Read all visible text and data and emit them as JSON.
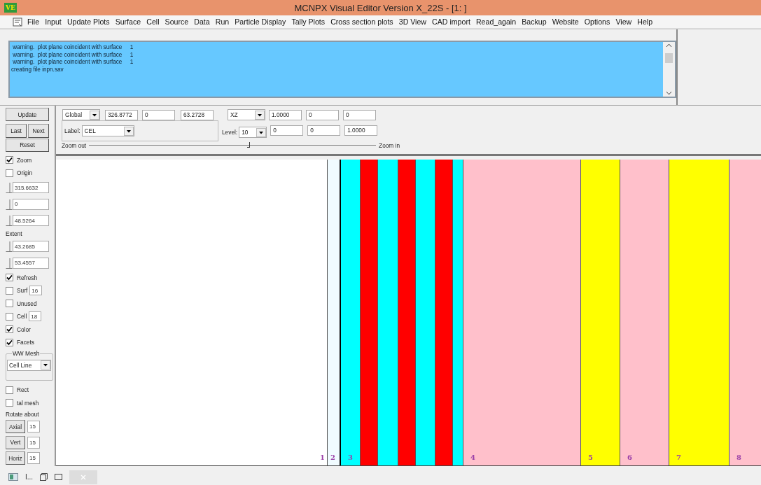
{
  "window": {
    "logo": "VE",
    "title": "MCNPX Visual Editor Version X_22S  - [1: ]"
  },
  "menu": [
    "File",
    "Input",
    "Update Plots",
    "Surface",
    "Cell",
    "Source",
    "Data",
    "Run",
    "Particle Display",
    "Tally Plots",
    "Cross section plots",
    "3D View",
    "CAD import",
    "Read_again",
    "Backup",
    "Website",
    "Options",
    "View",
    "Help"
  ],
  "messages": [
    " warning.  plot plane coincident with surface     1",
    " warning.  plot plane coincident with surface     1",
    " warning.  plot plane coincident with surface     1",
    "creating file inpn.sav"
  ],
  "toolbar": {
    "origin_mode": "Global",
    "origin": [
      "326.8772",
      "0",
      "63.2728"
    ],
    "plane": "XZ",
    "basis_1": [
      "1.0000",
      "0",
      "0"
    ],
    "label_title": "Label:",
    "label_value": "CEL",
    "level_title": "Level:",
    "level_value": "10",
    "basis_2": [
      "0",
      "0",
      "1.0000"
    ],
    "zoom_out": "Zoom out",
    "zoom_in": "Zoom in",
    "zoom": {
      "level": 0.55
    }
  },
  "sidebar": {
    "items": [
      {
        "kind": "button",
        "label": "Update"
      },
      {
        "kind": "button_pair",
        "labels": [
          "Last",
          "Next"
        ]
      },
      {
        "kind": "button",
        "label": "Reset"
      },
      {
        "kind": "checkbox",
        "label": "Zoom",
        "checked": true
      },
      {
        "kind": "checkbox",
        "label": "Origin",
        "checked": false
      },
      {
        "kind": "slider_field",
        "value": "315.6632"
      },
      {
        "kind": "slider_field",
        "value": "0"
      },
      {
        "kind": "slider_field",
        "value": "48.5264"
      },
      {
        "kind": "label",
        "text": "Extent"
      },
      {
        "kind": "slider_field",
        "value": "43.2685"
      },
      {
        "kind": "slider_field",
        "value": "53.4557"
      },
      {
        "kind": "checkbox",
        "label": "Refresh",
        "checked": true
      },
      {
        "kind": "checkbox",
        "label": "Surf",
        "checked": false,
        "value": "16"
      },
      {
        "kind": "checkbox",
        "label": "Unused",
        "checked": false
      },
      {
        "kind": "checkbox",
        "label": "Cell",
        "checked": false,
        "value": "18"
      },
      {
        "kind": "checkbox",
        "label": "Color",
        "checked": true
      },
      {
        "kind": "checkbox",
        "label": "Facets",
        "checked": true
      },
      {
        "kind": "group_dropdown",
        "title": "WW Mesh",
        "value": "Cell Line"
      },
      {
        "kind": "checkbox",
        "label": "Rect",
        "checked": false
      },
      {
        "kind": "checkbox",
        "label": "tal mesh",
        "checked": false
      },
      {
        "kind": "label",
        "text": "Rotate about"
      },
      {
        "kind": "button_field",
        "label": "Axial",
        "value": "15"
      },
      {
        "kind": "button_field",
        "label": "Vert",
        "value": "15"
      },
      {
        "kind": "button_field",
        "label": "Horiz",
        "value": "15"
      }
    ]
  },
  "plot": {
    "cells": [
      {
        "label": "1",
        "color": "#ffffff"
      },
      {
        "label": "2",
        "color": "#f0fbff"
      },
      {
        "label": "3",
        "color": "#00ffff"
      },
      {
        "color": "#ff0000"
      },
      {
        "color": "#00ffff"
      },
      {
        "color": "#ff0000"
      },
      {
        "color": "#00ffff"
      },
      {
        "color": "#ff0000"
      },
      {
        "color": "#00ffff"
      },
      {
        "label": "4",
        "color": "#ffc0cb"
      },
      {
        "label": "5",
        "color": "#ffff00"
      },
      {
        "label": "6",
        "color": "#ffc0cb"
      },
      {
        "label": "7",
        "color": "#ffff00"
      },
      {
        "label": "8",
        "color": "#ffc0cb"
      }
    ]
  },
  "taskbar": {
    "item": "I..."
  }
}
